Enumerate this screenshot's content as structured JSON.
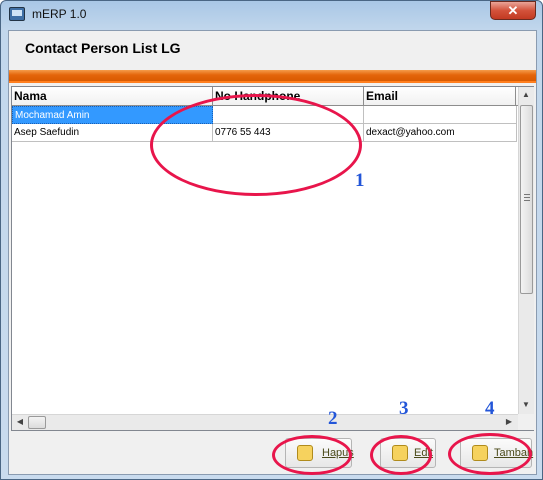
{
  "window": {
    "title": "mERP 1.0",
    "close_glyph": "✕"
  },
  "page": {
    "title": "Contact Person List LG"
  },
  "table": {
    "columns": [
      "Nama",
      "No Handphone",
      "Email"
    ],
    "rows": [
      {
        "nama": "Mochamad Amin",
        "hp": "",
        "email": "",
        "selected": true
      },
      {
        "nama": "Asep Saefudin",
        "hp": "0776 55 443",
        "email": "dexact@yahoo.com",
        "selected": false
      }
    ]
  },
  "buttons": {
    "hapus": "Hapus",
    "edit": "Edit",
    "tambah": "Tambah"
  },
  "annotations": [
    "1",
    "2",
    "3",
    "4"
  ],
  "colors": {
    "accent_orange": "#e4650b",
    "annotation_red": "#e8154b",
    "annotation_blue": "#2356d8",
    "selection_blue": "#3399ff"
  },
  "icons": [
    "app-icon",
    "close-icon",
    "delete-icon",
    "edit-icon",
    "add-icon"
  ]
}
